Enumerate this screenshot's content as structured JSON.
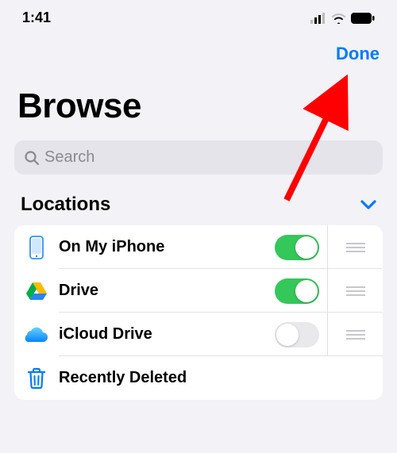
{
  "status": {
    "time": "1:41"
  },
  "nav": {
    "done_label": "Done"
  },
  "title": "Browse",
  "search": {
    "placeholder": "Search"
  },
  "section": {
    "title": "Locations"
  },
  "locations": [
    {
      "label": "On My iPhone",
      "toggle": true
    },
    {
      "label": "Drive",
      "toggle": true
    },
    {
      "label": "iCloud Drive",
      "toggle": false
    },
    {
      "label": "Recently Deleted"
    }
  ]
}
